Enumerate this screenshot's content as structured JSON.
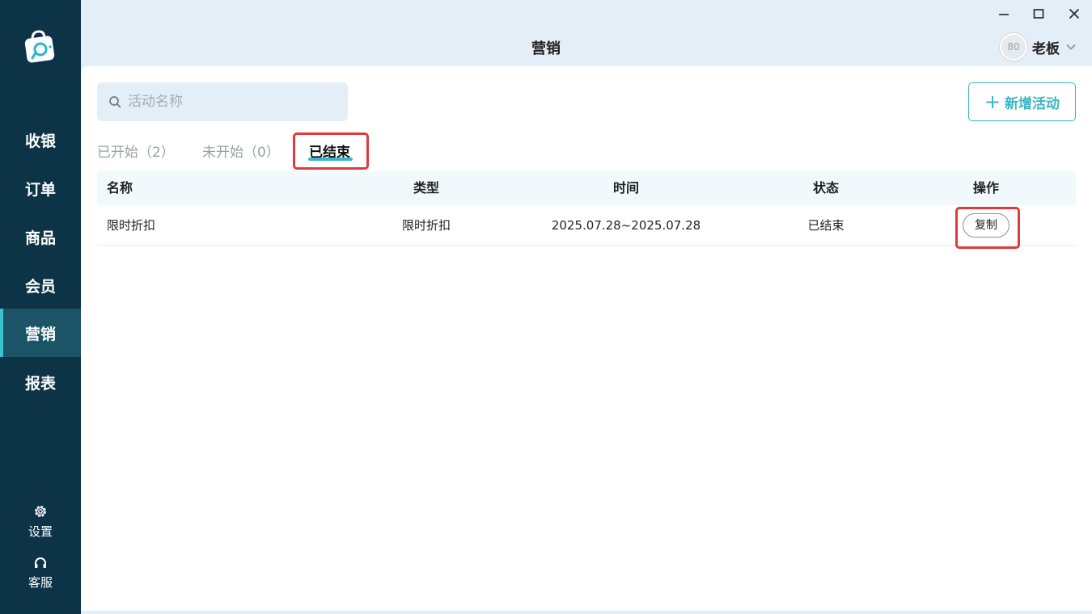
{
  "sidebar": {
    "logo": "shopping-bag-logo",
    "items": [
      {
        "label": "收银"
      },
      {
        "label": "订单"
      },
      {
        "label": "商品"
      },
      {
        "label": "会员"
      },
      {
        "label": "营销",
        "active": true
      },
      {
        "label": "报表"
      }
    ],
    "settings_label": "设置",
    "service_label": "客服"
  },
  "window_controls": [
    "minimize-icon",
    "maximize-icon",
    "close-icon"
  ],
  "header": {
    "title": "营销",
    "user": {
      "avatar_text": "80",
      "name": "老板"
    }
  },
  "search": {
    "placeholder": "活动名称",
    "value": ""
  },
  "add_button": {
    "label": "新增活动"
  },
  "tabs": [
    {
      "label": "已开始（2）"
    },
    {
      "label": "未开始（0）"
    },
    {
      "label": "已结束",
      "active": true
    }
  ],
  "table": {
    "columns": [
      "名称",
      "类型",
      "时间",
      "状态",
      "操作"
    ],
    "rows": [
      {
        "name": "限时折扣",
        "type": "限时折扣",
        "time": "2025.07.28~2025.07.28",
        "status": "已结束",
        "action": "复制"
      }
    ]
  },
  "colors": {
    "sidebar_bg": "#0d3347",
    "sidebar_active": "#1a5466",
    "accent": "#3ab6c4",
    "highlight_box": "#e0393e",
    "header_bg": "#e3eef6"
  }
}
